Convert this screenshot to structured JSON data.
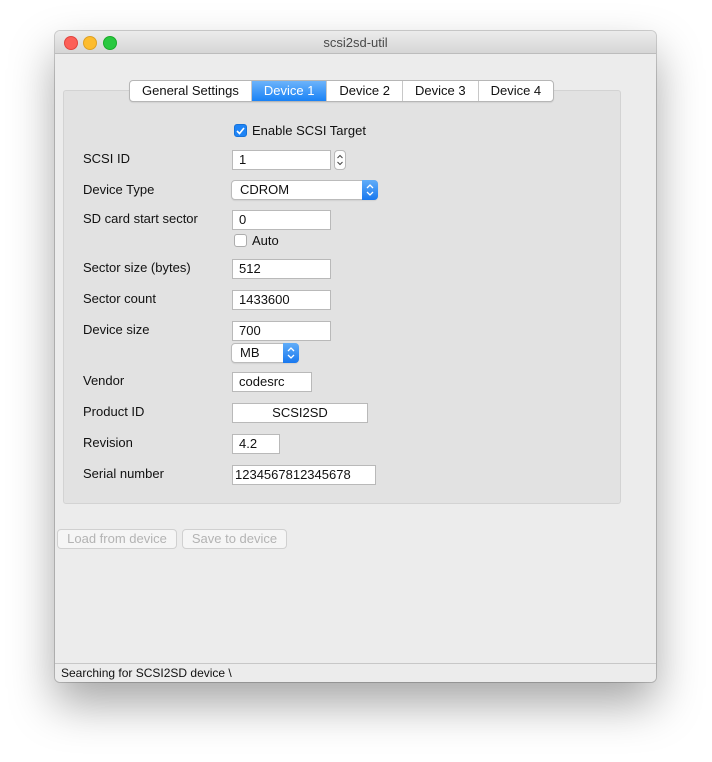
{
  "window": {
    "title": "scsi2sd-util"
  },
  "tabs": [
    "General Settings",
    "Device 1",
    "Device 2",
    "Device 3",
    "Device 4"
  ],
  "active_tab": "Device 1",
  "form": {
    "enable_label": "Enable SCSI Target",
    "enable_checked": true,
    "scsi_id_label": "SCSI ID",
    "scsi_id_value": "1",
    "device_type_label": "Device Type",
    "device_type_value": "CDROM",
    "sd_start_label": "SD card start sector",
    "sd_start_value": "0",
    "auto_label": "Auto",
    "auto_checked": false,
    "sector_size_label": "Sector size (bytes)",
    "sector_size_value": "512",
    "sector_count_label": "Sector count",
    "sector_count_value": "1433600",
    "device_size_label": "Device size",
    "device_size_value": "700",
    "device_size_unit": "MB",
    "vendor_label": "Vendor",
    "vendor_value": "codesrc",
    "product_id_label": "Product ID",
    "product_id_value": "SCSI2SD",
    "revision_label": "Revision",
    "revision_value": "4.2",
    "serial_label": "Serial number",
    "serial_value": "1234567812345678"
  },
  "buttons": {
    "load": "Load from device",
    "save": "Save to device"
  },
  "status": {
    "text": "Searching for SCSI2SD device \\"
  },
  "colors": {
    "accent": "#1a82f6",
    "close": "#fc5f57",
    "minimize": "#fdbc2e",
    "maximize": "#29c840"
  }
}
